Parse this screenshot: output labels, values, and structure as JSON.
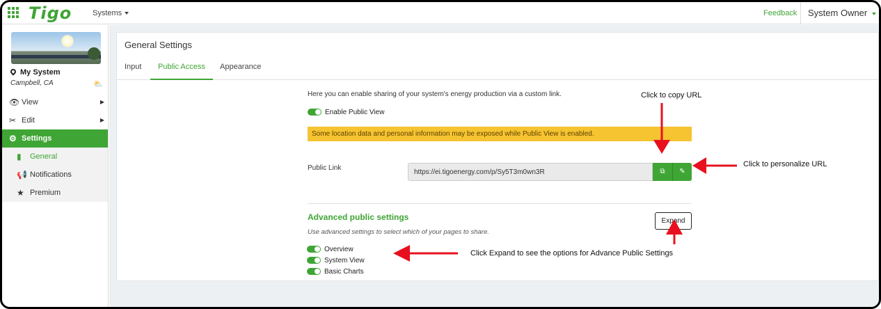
{
  "header": {
    "logo": "Tigo",
    "systems_menu": "Systems",
    "feedback": "Feedback",
    "user_menu": "System Owner"
  },
  "sidebar": {
    "system_name": "My System",
    "location": "Campbell, CA",
    "weather_icon": "partly-cloudy-icon",
    "items": [
      {
        "label": "View",
        "icon": "eye-icon"
      },
      {
        "label": "Edit",
        "icon": "tools-icon"
      },
      {
        "label": "Settings",
        "icon": "gear-icon"
      }
    ],
    "settings_sub": [
      {
        "label": "General",
        "icon": "book-icon"
      },
      {
        "label": "Notifications",
        "icon": "megaphone-icon"
      },
      {
        "label": "Premium",
        "icon": "star-icon"
      }
    ]
  },
  "main": {
    "card_title": "General Settings",
    "tabs": [
      {
        "label": "Input"
      },
      {
        "label": "Public Access"
      },
      {
        "label": "Appearance"
      }
    ],
    "description": "Here you can enable sharing of your system's energy production via a custom link.",
    "enable_label": "Enable Public View",
    "warning": "Some location data and personal information may be exposed while Public View is enabled.",
    "public_link_label": "Public Link",
    "public_link_value": "https://ei.tigoenergy.com/p/Sy5T3m0wn3R",
    "advanced_title": "Advanced public settings",
    "advanced_desc": "Use advanced settings to select which of your pages to share.",
    "expand_label": "Expand",
    "options": [
      {
        "label": "Overview"
      },
      {
        "label": "System View"
      },
      {
        "label": "Basic Charts"
      }
    ]
  },
  "annotations": {
    "copy_note": "Click to copy URL",
    "personalize_note": "Click to personalize URL",
    "expand_note": "Click Expand to see the options for Advance Public Settings"
  },
  "colors": {
    "brand_green": "#3fa535",
    "warning_yellow": "#f6c331",
    "annotation_red": "#e8101e"
  }
}
